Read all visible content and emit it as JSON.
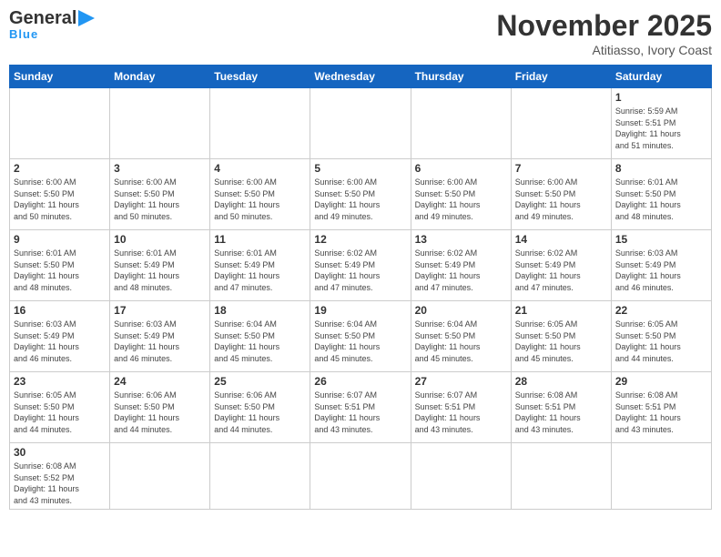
{
  "header": {
    "logo_general": "General",
    "logo_blue": "Blue",
    "month_title": "November 2025",
    "location": "Atitiasso, Ivory Coast"
  },
  "days_of_week": [
    "Sunday",
    "Monday",
    "Tuesday",
    "Wednesday",
    "Thursday",
    "Friday",
    "Saturday"
  ],
  "weeks": [
    [
      {
        "day": "",
        "info": ""
      },
      {
        "day": "",
        "info": ""
      },
      {
        "day": "",
        "info": ""
      },
      {
        "day": "",
        "info": ""
      },
      {
        "day": "",
        "info": ""
      },
      {
        "day": "",
        "info": ""
      },
      {
        "day": "1",
        "info": "Sunrise: 5:59 AM\nSunset: 5:51 PM\nDaylight: 11 hours\nand 51 minutes."
      }
    ],
    [
      {
        "day": "2",
        "info": "Sunrise: 6:00 AM\nSunset: 5:50 PM\nDaylight: 11 hours\nand 50 minutes."
      },
      {
        "day": "3",
        "info": "Sunrise: 6:00 AM\nSunset: 5:50 PM\nDaylight: 11 hours\nand 50 minutes."
      },
      {
        "day": "4",
        "info": "Sunrise: 6:00 AM\nSunset: 5:50 PM\nDaylight: 11 hours\nand 50 minutes."
      },
      {
        "day": "5",
        "info": "Sunrise: 6:00 AM\nSunset: 5:50 PM\nDaylight: 11 hours\nand 49 minutes."
      },
      {
        "day": "6",
        "info": "Sunrise: 6:00 AM\nSunset: 5:50 PM\nDaylight: 11 hours\nand 49 minutes."
      },
      {
        "day": "7",
        "info": "Sunrise: 6:00 AM\nSunset: 5:50 PM\nDaylight: 11 hours\nand 49 minutes."
      },
      {
        "day": "8",
        "info": "Sunrise: 6:01 AM\nSunset: 5:50 PM\nDaylight: 11 hours\nand 48 minutes."
      }
    ],
    [
      {
        "day": "9",
        "info": "Sunrise: 6:01 AM\nSunset: 5:50 PM\nDaylight: 11 hours\nand 48 minutes."
      },
      {
        "day": "10",
        "info": "Sunrise: 6:01 AM\nSunset: 5:49 PM\nDaylight: 11 hours\nand 48 minutes."
      },
      {
        "day": "11",
        "info": "Sunrise: 6:01 AM\nSunset: 5:49 PM\nDaylight: 11 hours\nand 47 minutes."
      },
      {
        "day": "12",
        "info": "Sunrise: 6:02 AM\nSunset: 5:49 PM\nDaylight: 11 hours\nand 47 minutes."
      },
      {
        "day": "13",
        "info": "Sunrise: 6:02 AM\nSunset: 5:49 PM\nDaylight: 11 hours\nand 47 minutes."
      },
      {
        "day": "14",
        "info": "Sunrise: 6:02 AM\nSunset: 5:49 PM\nDaylight: 11 hours\nand 47 minutes."
      },
      {
        "day": "15",
        "info": "Sunrise: 6:03 AM\nSunset: 5:49 PM\nDaylight: 11 hours\nand 46 minutes."
      }
    ],
    [
      {
        "day": "16",
        "info": "Sunrise: 6:03 AM\nSunset: 5:49 PM\nDaylight: 11 hours\nand 46 minutes."
      },
      {
        "day": "17",
        "info": "Sunrise: 6:03 AM\nSunset: 5:49 PM\nDaylight: 11 hours\nand 46 minutes."
      },
      {
        "day": "18",
        "info": "Sunrise: 6:04 AM\nSunset: 5:50 PM\nDaylight: 11 hours\nand 45 minutes."
      },
      {
        "day": "19",
        "info": "Sunrise: 6:04 AM\nSunset: 5:50 PM\nDaylight: 11 hours\nand 45 minutes."
      },
      {
        "day": "20",
        "info": "Sunrise: 6:04 AM\nSunset: 5:50 PM\nDaylight: 11 hours\nand 45 minutes."
      },
      {
        "day": "21",
        "info": "Sunrise: 6:05 AM\nSunset: 5:50 PM\nDaylight: 11 hours\nand 45 minutes."
      },
      {
        "day": "22",
        "info": "Sunrise: 6:05 AM\nSunset: 5:50 PM\nDaylight: 11 hours\nand 44 minutes."
      }
    ],
    [
      {
        "day": "23",
        "info": "Sunrise: 6:05 AM\nSunset: 5:50 PM\nDaylight: 11 hours\nand 44 minutes."
      },
      {
        "day": "24",
        "info": "Sunrise: 6:06 AM\nSunset: 5:50 PM\nDaylight: 11 hours\nand 44 minutes."
      },
      {
        "day": "25",
        "info": "Sunrise: 6:06 AM\nSunset: 5:50 PM\nDaylight: 11 hours\nand 44 minutes."
      },
      {
        "day": "26",
        "info": "Sunrise: 6:07 AM\nSunset: 5:51 PM\nDaylight: 11 hours\nand 43 minutes."
      },
      {
        "day": "27",
        "info": "Sunrise: 6:07 AM\nSunset: 5:51 PM\nDaylight: 11 hours\nand 43 minutes."
      },
      {
        "day": "28",
        "info": "Sunrise: 6:08 AM\nSunset: 5:51 PM\nDaylight: 11 hours\nand 43 minutes."
      },
      {
        "day": "29",
        "info": "Sunrise: 6:08 AM\nSunset: 5:51 PM\nDaylight: 11 hours\nand 43 minutes."
      }
    ],
    [
      {
        "day": "30",
        "info": "Sunrise: 6:08 AM\nSunset: 5:52 PM\nDaylight: 11 hours\nand 43 minutes."
      },
      {
        "day": "",
        "info": ""
      },
      {
        "day": "",
        "info": ""
      },
      {
        "day": "",
        "info": ""
      },
      {
        "day": "",
        "info": ""
      },
      {
        "day": "",
        "info": ""
      },
      {
        "day": "",
        "info": ""
      }
    ]
  ]
}
